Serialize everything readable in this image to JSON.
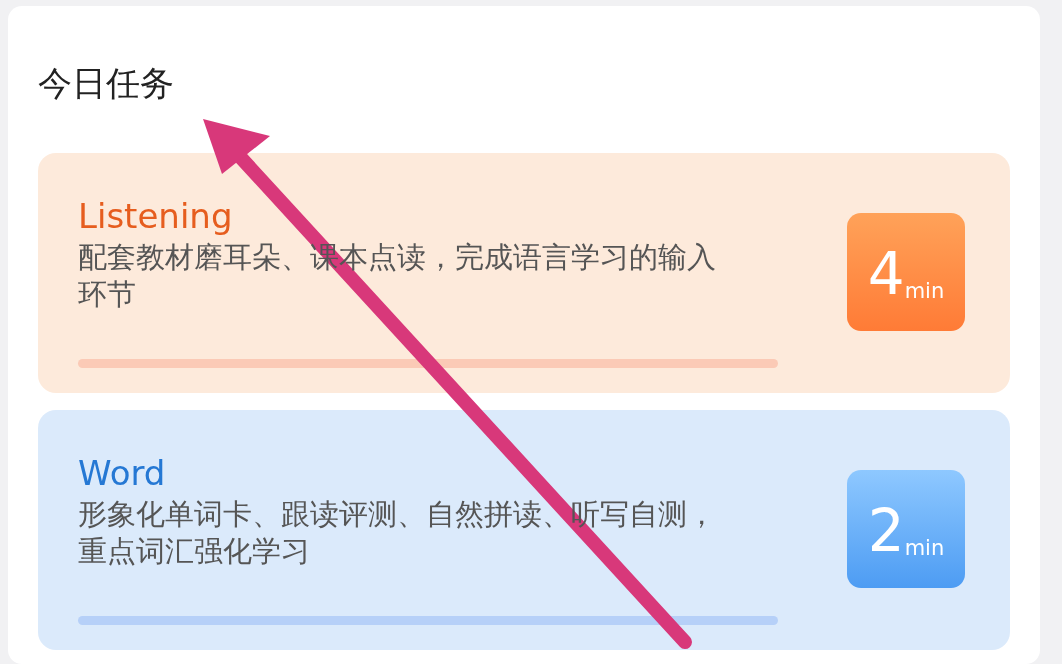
{
  "title": "今日任务",
  "tasks": [
    {
      "kind": "listening",
      "name": "Listening",
      "description": "配套教材磨耳朵、课本点读，完成语言学习的输入环节",
      "duration": "4",
      "unit": "min"
    },
    {
      "kind": "word",
      "name": "Word",
      "description": "形象化单词卡、跟读评测、自然拼读、听写自测，重点词汇强化学习",
      "duration": "2",
      "unit": "min"
    }
  ]
}
